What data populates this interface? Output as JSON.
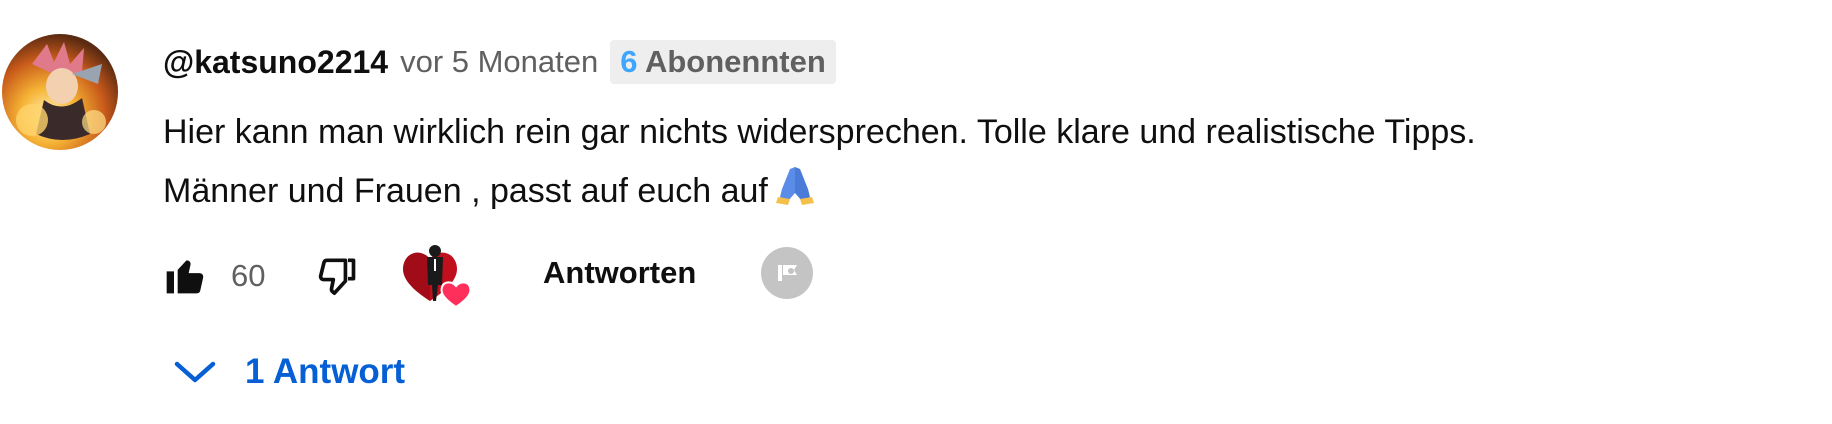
{
  "comment": {
    "author": "@katsuno2214",
    "time": "vor 5 Monaten",
    "badge": {
      "number": "6",
      "text": "Abonennten"
    },
    "text_line1": "Hier kann man wirklich rein gar nichts widersprechen. Tolle klare und realistische Tipps.",
    "text_line2": "Männer und Frauen , passt auf euch auf",
    "emoji_icon": "folded-hands-icon"
  },
  "actions": {
    "like_count": "60",
    "reply_label": "Antworten",
    "icons": [
      "thumbs-up-icon",
      "thumbs-down-icon",
      "creator-heart-icon",
      "more-icon"
    ]
  },
  "replies": {
    "label": "1 Antwort"
  },
  "colors": {
    "link_blue": "#065fd4",
    "badge_blue": "#3ea6ff",
    "meta_gray": "#606060",
    "heart_red": "#e31b33"
  }
}
